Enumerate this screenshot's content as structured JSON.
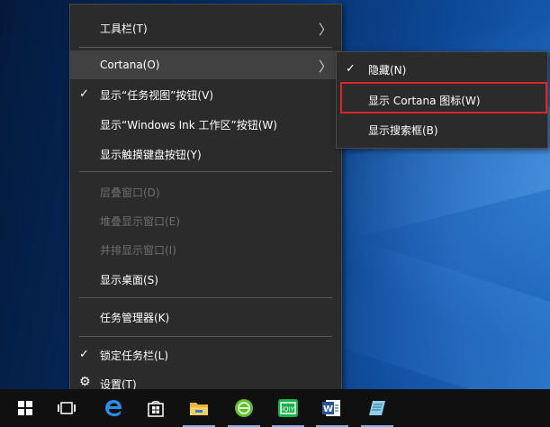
{
  "context_menu": {
    "items": [
      {
        "label": "工具栏(T)",
        "submenu": true
      },
      {
        "label": "Cortana(O)",
        "submenu": true
      },
      {
        "label": "显示“任务视图”按钮(V)",
        "checked": true
      },
      {
        "label": "显示“Windows Ink 工作区”按钮(W)"
      },
      {
        "label": "显示触摸键盘按钮(Y)"
      },
      {
        "label": "层叠窗口(D)",
        "disabled": true
      },
      {
        "label": "堆叠显示窗口(E)",
        "disabled": true
      },
      {
        "label": "并排显示窗口(I)",
        "disabled": true
      },
      {
        "label": "显示桌面(S)"
      },
      {
        "label": "任务管理器(K)"
      },
      {
        "label": "锁定任务栏(L)",
        "checked": true
      },
      {
        "label": "设置(T)"
      }
    ]
  },
  "cortana_submenu": {
    "items": [
      {
        "label": "隐藏(N)",
        "checked": true
      },
      {
        "label": "显示 Cortana 图标(W)",
        "highlighted": true
      },
      {
        "label": "显示搜索框(B)"
      }
    ]
  },
  "taskbar": {
    "icons": [
      "windows-start-icon",
      "task-view-icon",
      "edge-browser-icon",
      "store-icon",
      "file-explorer-icon",
      "green-app-icon",
      "iqiyi-icon",
      "word-icon",
      "notepad-app-icon"
    ]
  },
  "colors": {
    "menu_bg": "#2b2b2b",
    "hover_bg": "#414141",
    "highlight_border": "#d9262c",
    "taskbar_bg": "#101010"
  }
}
